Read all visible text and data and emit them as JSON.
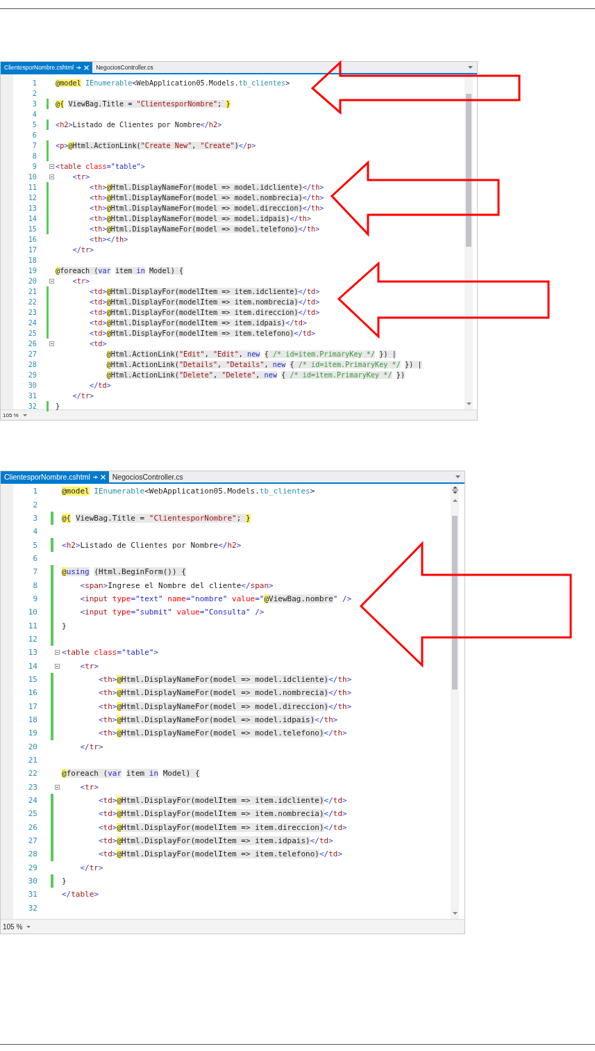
{
  "editors": [
    {
      "tabs": [
        {
          "label": "ClientesporNombre.cshtml",
          "selected": true
        },
        {
          "label": "NegociosController.cs",
          "selected": false
        }
      ],
      "zoom": "105 %",
      "lines": [
        {
          "number": "1",
          "changed": false,
          "fold": false,
          "segments": [
            {
              "text": "@model",
              "kind": "razor"
            },
            {
              "text": " IEnumerable",
              "kind": "type"
            },
            {
              "text": "<WebApplication05.Models.",
              "kind": "plain"
            },
            {
              "text": "tb_clientes",
              "kind": "type"
            },
            {
              "text": ">",
              "kind": "plain"
            }
          ]
        },
        {
          "number": "2",
          "changed": false,
          "fold": false
        },
        {
          "number": "3",
          "changed": true,
          "fold": false,
          "segments": [
            {
              "text": "@{",
              "kind": "razor"
            },
            {
              "text": " ViewBag.Title = ",
              "kind": "cs"
            },
            {
              "text": "\"ClientesporNombre\"",
              "kind": "cs-str"
            },
            {
              "text": "; ",
              "kind": "cs"
            },
            {
              "text": "}",
              "kind": "razor"
            }
          ]
        },
        {
          "number": "4",
          "changed": false,
          "fold": false
        },
        {
          "number": "5",
          "changed": true,
          "fold": false,
          "segments": [
            {
              "text": "<",
              "kind": "punct"
            },
            {
              "text": "h2",
              "kind": "tag"
            },
            {
              "text": ">",
              "kind": "punct"
            },
            {
              "text": "Listado de Clientes por Nombre",
              "kind": "plain"
            },
            {
              "text": "</",
              "kind": "punct"
            },
            {
              "text": "h2",
              "kind": "tag"
            },
            {
              "text": ">",
              "kind": "punct"
            }
          ]
        },
        {
          "number": "6",
          "changed": false,
          "fold": false
        },
        {
          "number": "7",
          "changed": true,
          "fold": false,
          "segments": [
            {
              "text": "<",
              "kind": "punct"
            },
            {
              "text": "p",
              "kind": "tag"
            },
            {
              "text": ">",
              "kind": "punct"
            },
            {
              "text": "@",
              "kind": "razor"
            },
            {
              "text": "Html.ActionLink(",
              "kind": "cs"
            },
            {
              "text": "\"Create New\"",
              "kind": "cs-str"
            },
            {
              "text": ", ",
              "kind": "cs"
            },
            {
              "text": "\"Create\"",
              "kind": "cs-str"
            },
            {
              "text": ")",
              "kind": "cs"
            },
            {
              "text": "</",
              "kind": "punct"
            },
            {
              "text": "p",
              "kind": "tag"
            },
            {
              "text": ">",
              "kind": "punct"
            }
          ]
        },
        {
          "number": "8",
          "changed": true,
          "fold": false
        },
        {
          "number": "9",
          "changed": false,
          "fold": true,
          "segments": [
            {
              "text": "<",
              "kind": "punct"
            },
            {
              "text": "table",
              "kind": "tag"
            },
            {
              "text": " class",
              "kind": "attr"
            },
            {
              "text": "=",
              "kind": "punct"
            },
            {
              "text": "\"table\"",
              "kind": "value"
            },
            {
              "text": ">",
              "kind": "punct"
            }
          ]
        },
        {
          "number": "10",
          "changed": false,
          "fold": true,
          "segments": [
            {
              "text": "    <",
              "kind": "punct"
            },
            {
              "text": "tr",
              "kind": "tag"
            },
            {
              "text": ">",
              "kind": "punct"
            }
          ]
        },
        {
          "number": "11",
          "changed": true,
          "fold": false,
          "segments": [
            {
              "text": "        <",
              "kind": "punct"
            },
            {
              "text": "th",
              "kind": "tag"
            },
            {
              "text": ">",
              "kind": "punct"
            },
            {
              "text": "@",
              "kind": "razor"
            },
            {
              "text": "Html.DisplayNameFor(model => model.idcliente)",
              "kind": "cs"
            },
            {
              "text": "</",
              "kind": "punct"
            },
            {
              "text": "th",
              "kind": "tag"
            },
            {
              "text": ">",
              "kind": "punct"
            }
          ]
        },
        {
          "number": "12",
          "changed": true,
          "fold": false,
          "segments": [
            {
              "text": "        <",
              "kind": "punct"
            },
            {
              "text": "th",
              "kind": "tag"
            },
            {
              "text": ">",
              "kind": "punct"
            },
            {
              "text": "@",
              "kind": "razor"
            },
            {
              "text": "Html.DisplayNameFor(model => model.nombrecia)",
              "kind": "cs"
            },
            {
              "text": "</",
              "kind": "punct"
            },
            {
              "text": "th",
              "kind": "tag"
            },
            {
              "text": ">",
              "kind": "punct"
            }
          ]
        },
        {
          "number": "13",
          "changed": true,
          "fold": false,
          "segments": [
            {
              "text": "        <",
              "kind": "punct"
            },
            {
              "text": "th",
              "kind": "tag"
            },
            {
              "text": ">",
              "kind": "punct"
            },
            {
              "text": "@",
              "kind": "razor"
            },
            {
              "text": "Html.DisplayNameFor(model => model.direccion)",
              "kind": "cs"
            },
            {
              "text": "</",
              "kind": "punct"
            },
            {
              "text": "th",
              "kind": "tag"
            },
            {
              "text": ">",
              "kind": "punct"
            }
          ]
        },
        {
          "number": "14",
          "changed": true,
          "fold": false,
          "segments": [
            {
              "text": "        <",
              "kind": "punct"
            },
            {
              "text": "th",
              "kind": "tag"
            },
            {
              "text": ">",
              "kind": "punct"
            },
            {
              "text": "@",
              "kind": "razor"
            },
            {
              "text": "Html.DisplayNameFor(model => model.idpais)",
              "kind": "cs"
            },
            {
              "text": "</",
              "kind": "punct"
            },
            {
              "text": "th",
              "kind": "tag"
            },
            {
              "text": ">",
              "kind": "punct"
            }
          ]
        },
        {
          "number": "15",
          "changed": true,
          "fold": false,
          "segments": [
            {
              "text": "        <",
              "kind": "punct"
            },
            {
              "text": "th",
              "kind": "tag"
            },
            {
              "text": ">",
              "kind": "punct"
            },
            {
              "text": "@",
              "kind": "razor"
            },
            {
              "text": "Html.DisplayNameFor(model => model.telefono)",
              "kind": "cs"
            },
            {
              "text": "</",
              "kind": "punct"
            },
            {
              "text": "th",
              "kind": "tag"
            },
            {
              "text": ">",
              "kind": "punct"
            }
          ]
        },
        {
          "number": "16",
          "changed": false,
          "fold": false,
          "segments": [
            {
              "text": "        <",
              "kind": "punct"
            },
            {
              "text": "th",
              "kind": "tag"
            },
            {
              "text": "></",
              "kind": "punct"
            },
            {
              "text": "th",
              "kind": "tag"
            },
            {
              "text": ">",
              "kind": "punct"
            }
          ]
        },
        {
          "number": "17",
          "changed": false,
          "fold": false,
          "segments": [
            {
              "text": "    </",
              "kind": "punct"
            },
            {
              "text": "tr",
              "kind": "tag"
            },
            {
              "text": ">",
              "kind": "punct"
            }
          ]
        },
        {
          "number": "18",
          "changed": false,
          "fold": false
        },
        {
          "number": "19",
          "changed": false,
          "fold": false,
          "segments": [
            {
              "text": "@",
              "kind": "razor"
            },
            {
              "text": "foreach (",
              "kind": "cs"
            },
            {
              "text": "var",
              "kind": "cs-kw"
            },
            {
              "text": " item ",
              "kind": "cs"
            },
            {
              "text": "in",
              "kind": "cs-kw"
            },
            {
              "text": " Model) {",
              "kind": "cs"
            }
          ]
        },
        {
          "number": "20",
          "changed": false,
          "fold": true,
          "segments": [
            {
              "text": "    <",
              "kind": "punct"
            },
            {
              "text": "tr",
              "kind": "tag"
            },
            {
              "text": ">",
              "kind": "punct"
            }
          ]
        },
        {
          "number": "21",
          "changed": true,
          "fold": false,
          "segments": [
            {
              "text": "        <",
              "kind": "punct"
            },
            {
              "text": "td",
              "kind": "tag"
            },
            {
              "text": ">",
              "kind": "punct"
            },
            {
              "text": "@",
              "kind": "razor"
            },
            {
              "text": "Html.DisplayFor(modelItem => item.idcliente)",
              "kind": "cs"
            },
            {
              "text": "</",
              "kind": "punct"
            },
            {
              "text": "td",
              "kind": "tag"
            },
            {
              "text": ">",
              "kind": "punct"
            }
          ]
        },
        {
          "number": "22",
          "changed": true,
          "fold": false,
          "segments": [
            {
              "text": "        <",
              "kind": "punct"
            },
            {
              "text": "td",
              "kind": "tag"
            },
            {
              "text": ">",
              "kind": "punct"
            },
            {
              "text": "@",
              "kind": "razor"
            },
            {
              "text": "Html.DisplayFor(modelItem => item.nombrecia)",
              "kind": "cs"
            },
            {
              "text": "</",
              "kind": "punct"
            },
            {
              "text": "td",
              "kind": "tag"
            },
            {
              "text": ">",
              "kind": "punct"
            }
          ]
        },
        {
          "number": "23",
          "changed": true,
          "fold": false,
          "segments": [
            {
              "text": "        <",
              "kind": "punct"
            },
            {
              "text": "td",
              "kind": "tag"
            },
            {
              "text": ">",
              "kind": "punct"
            },
            {
              "text": "@",
              "kind": "razor"
            },
            {
              "text": "Html.DisplayFor(modelItem => item.direccion)",
              "kind": "cs"
            },
            {
              "text": "</",
              "kind": "punct"
            },
            {
              "text": "td",
              "kind": "tag"
            },
            {
              "text": ">",
              "kind": "punct"
            }
          ]
        },
        {
          "number": "24",
          "changed": true,
          "fold": false,
          "segments": [
            {
              "text": "        <",
              "kind": "punct"
            },
            {
              "text": "td",
              "kind": "tag"
            },
            {
              "text": ">",
              "kind": "punct"
            },
            {
              "text": "@",
              "kind": "razor"
            },
            {
              "text": "Html.DisplayFor(modelItem => item.idpais)",
              "kind": "cs"
            },
            {
              "text": "</",
              "kind": "punct"
            },
            {
              "text": "td",
              "kind": "tag"
            },
            {
              "text": ">",
              "kind": "punct"
            }
          ]
        },
        {
          "number": "25",
          "changed": true,
          "fold": false,
          "segments": [
            {
              "text": "        <",
              "kind": "punct"
            },
            {
              "text": "td",
              "kind": "tag"
            },
            {
              "text": ">",
              "kind": "punct"
            },
            {
              "text": "@",
              "kind": "razor"
            },
            {
              "text": "Html.DisplayFor(modelItem => item.telefono)",
              "kind": "cs"
            },
            {
              "text": "</",
              "kind": "punct"
            },
            {
              "text": "td",
              "kind": "tag"
            },
            {
              "text": ">",
              "kind": "punct"
            }
          ]
        },
        {
          "number": "26",
          "changed": false,
          "fold": true,
          "segments": [
            {
              "text": "        <",
              "kind": "punct"
            },
            {
              "text": "td",
              "kind": "tag"
            },
            {
              "text": ">",
              "kind": "punct"
            }
          ]
        },
        {
          "number": "27",
          "changed": false,
          "fold": false,
          "segments": [
            {
              "text": "            @",
              "kind": "razor"
            },
            {
              "text": "Html.ActionLink(",
              "kind": "cs"
            },
            {
              "text": "\"Edit\"",
              "kind": "cs-str"
            },
            {
              "text": ", ",
              "kind": "cs"
            },
            {
              "text": "\"Edit\"",
              "kind": "cs-str"
            },
            {
              "text": ", ",
              "kind": "cs"
            },
            {
              "text": "new",
              "kind": "cs-kw"
            },
            {
              "text": " { ",
              "kind": "cs"
            },
            {
              "text": "/* id=item.PrimaryKey */",
              "kind": "cs-cmt"
            },
            {
              "text": " }) |",
              "kind": "cs"
            }
          ]
        },
        {
          "number": "28",
          "changed": false,
          "fold": false,
          "segments": [
            {
              "text": "            @",
              "kind": "razor"
            },
            {
              "text": "Html.ActionLink(",
              "kind": "cs"
            },
            {
              "text": "\"Details\"",
              "kind": "cs-str"
            },
            {
              "text": ", ",
              "kind": "cs"
            },
            {
              "text": "\"Details\"",
              "kind": "cs-str"
            },
            {
              "text": ", ",
              "kind": "cs"
            },
            {
              "text": "new",
              "kind": "cs-kw"
            },
            {
              "text": " { ",
              "kind": "cs"
            },
            {
              "text": "/* id=item.PrimaryKey */",
              "kind": "cs-cmt"
            },
            {
              "text": " }) |",
              "kind": "cs"
            }
          ]
        },
        {
          "number": "29",
          "changed": false,
          "fold": false,
          "segments": [
            {
              "text": "            @",
              "kind": "razor"
            },
            {
              "text": "Html.ActionLink(",
              "kind": "cs"
            },
            {
              "text": "\"Delete\"",
              "kind": "cs-str"
            },
            {
              "text": ", ",
              "kind": "cs"
            },
            {
              "text": "\"Delete\"",
              "kind": "cs-str"
            },
            {
              "text": ", ",
              "kind": "cs"
            },
            {
              "text": "new",
              "kind": "cs-kw"
            },
            {
              "text": " { ",
              "kind": "cs"
            },
            {
              "text": "/* id=item.PrimaryKey */",
              "kind": "cs-cmt"
            },
            {
              "text": " })",
              "kind": "cs"
            }
          ]
        },
        {
          "number": "30",
          "changed": false,
          "fold": false,
          "segments": [
            {
              "text": "        </",
              "kind": "punct"
            },
            {
              "text": "td",
              "kind": "tag"
            },
            {
              "text": ">",
              "kind": "punct"
            }
          ]
        },
        {
          "number": "31",
          "changed": false,
          "fold": false,
          "segments": [
            {
              "text": "    </",
              "kind": "punct"
            },
            {
              "text": "tr",
              "kind": "tag"
            },
            {
              "text": ">",
              "kind": "punct"
            }
          ]
        },
        {
          "number": "32",
          "changed": true,
          "fold": false,
          "segments": [
            {
              "text": "}",
              "kind": "plain"
            }
          ]
        }
      ]
    },
    {
      "tabs": [
        {
          "label": "ClientesporNombre.cshtml",
          "selected": true
        },
        {
          "label": "NegociosController.cs",
          "selected": false
        }
      ],
      "zoom": "105 %",
      "lines": [
        {
          "number": "1",
          "changed": false,
          "fold": false,
          "segments": [
            {
              "text": "@model",
              "kind": "razor"
            },
            {
              "text": " IEnumerable",
              "kind": "type"
            },
            {
              "text": "<WebApplication05.Models.",
              "kind": "plain"
            },
            {
              "text": "tb_clientes",
              "kind": "type"
            },
            {
              "text": ">",
              "kind": "plain"
            }
          ]
        },
        {
          "number": "2",
          "changed": false,
          "fold": false
        },
        {
          "number": "3",
          "changed": true,
          "fold": false,
          "segments": [
            {
              "text": "@{",
              "kind": "razor"
            },
            {
              "text": " ViewBag.Title = ",
              "kind": "cs"
            },
            {
              "text": "\"ClientesporNombre\"",
              "kind": "cs-str"
            },
            {
              "text": "; ",
              "kind": "cs"
            },
            {
              "text": "}",
              "kind": "razor"
            }
          ]
        },
        {
          "number": "4",
          "changed": false,
          "fold": false
        },
        {
          "number": "5",
          "changed": true,
          "fold": false,
          "segments": [
            {
              "text": "<",
              "kind": "punct"
            },
            {
              "text": "h2",
              "kind": "tag"
            },
            {
              "text": ">",
              "kind": "punct"
            },
            {
              "text": "Listado de Clientes por Nombre",
              "kind": "plain"
            },
            {
              "text": "</",
              "kind": "punct"
            },
            {
              "text": "h2",
              "kind": "tag"
            },
            {
              "text": ">",
              "kind": "punct"
            }
          ]
        },
        {
          "number": "6",
          "changed": false,
          "fold": false
        },
        {
          "number": "7",
          "changed": true,
          "fold": false,
          "segments": [
            {
              "text": "@",
              "kind": "razor"
            },
            {
              "text": "using",
              "kind": "cs-kw"
            },
            {
              "text": " (Html.BeginForm()) {",
              "kind": "cs"
            }
          ]
        },
        {
          "number": "8",
          "changed": true,
          "fold": false,
          "segments": [
            {
              "text": "    <",
              "kind": "punct"
            },
            {
              "text": "span",
              "kind": "tag"
            },
            {
              "text": ">",
              "kind": "punct"
            },
            {
              "text": "Ingrese el Nombre del cliente",
              "kind": "plain"
            },
            {
              "text": "</",
              "kind": "punct"
            },
            {
              "text": "span",
              "kind": "tag"
            },
            {
              "text": ">",
              "kind": "punct"
            }
          ]
        },
        {
          "number": "9",
          "changed": true,
          "fold": false,
          "segments": [
            {
              "text": "    <",
              "kind": "punct"
            },
            {
              "text": "input",
              "kind": "tag"
            },
            {
              "text": " type",
              "kind": "attr"
            },
            {
              "text": "=",
              "kind": "punct"
            },
            {
              "text": "\"text\"",
              "kind": "value"
            },
            {
              "text": " name",
              "kind": "attr"
            },
            {
              "text": "=",
              "kind": "punct"
            },
            {
              "text": "\"nombre\"",
              "kind": "value"
            },
            {
              "text": " value",
              "kind": "attr"
            },
            {
              "text": "=",
              "kind": "punct"
            },
            {
              "text": "\"",
              "kind": "value"
            },
            {
              "text": "@",
              "kind": "razor"
            },
            {
              "text": "ViewBag.nombre",
              "kind": "cs"
            },
            {
              "text": "\"",
              "kind": "value"
            },
            {
              "text": " />",
              "kind": "punct"
            }
          ]
        },
        {
          "number": "10",
          "changed": true,
          "fold": false,
          "segments": [
            {
              "text": "    <",
              "kind": "punct"
            },
            {
              "text": "input",
              "kind": "tag"
            },
            {
              "text": " type",
              "kind": "attr"
            },
            {
              "text": "=",
              "kind": "punct"
            },
            {
              "text": "\"submit\"",
              "kind": "value"
            },
            {
              "text": " value",
              "kind": "attr"
            },
            {
              "text": "=",
              "kind": "punct"
            },
            {
              "text": "\"Consulta\"",
              "kind": "value"
            },
            {
              "text": " />",
              "kind": "punct"
            }
          ]
        },
        {
          "number": "11",
          "changed": true,
          "fold": false,
          "segments": [
            {
              "text": "}",
              "kind": "plain"
            }
          ]
        },
        {
          "number": "12",
          "changed": true,
          "fold": false
        },
        {
          "number": "13",
          "changed": false,
          "fold": true,
          "segments": [
            {
              "text": "<",
              "kind": "punct"
            },
            {
              "text": "table",
              "kind": "tag"
            },
            {
              "text": " class",
              "kind": "attr"
            },
            {
              "text": "=",
              "kind": "punct"
            },
            {
              "text": "\"table\"",
              "kind": "value"
            },
            {
              "text": ">",
              "kind": "punct"
            }
          ]
        },
        {
          "number": "14",
          "changed": false,
          "fold": true,
          "segments": [
            {
              "text": "    <",
              "kind": "punct"
            },
            {
              "text": "tr",
              "kind": "tag"
            },
            {
              "text": ">",
              "kind": "punct"
            }
          ]
        },
        {
          "number": "15",
          "changed": true,
          "fold": false,
          "segments": [
            {
              "text": "        <",
              "kind": "punct"
            },
            {
              "text": "th",
              "kind": "tag"
            },
            {
              "text": ">",
              "kind": "punct"
            },
            {
              "text": "@",
              "kind": "razor"
            },
            {
              "text": "Html.DisplayNameFor(model => model.idcliente)",
              "kind": "cs"
            },
            {
              "text": "</",
              "kind": "punct"
            },
            {
              "text": "th",
              "kind": "tag"
            },
            {
              "text": ">",
              "kind": "punct"
            }
          ]
        },
        {
          "number": "16",
          "changed": true,
          "fold": false,
          "segments": [
            {
              "text": "        <",
              "kind": "punct"
            },
            {
              "text": "th",
              "kind": "tag"
            },
            {
              "text": ">",
              "kind": "punct"
            },
            {
              "text": "@",
              "kind": "razor"
            },
            {
              "text": "Html.DisplayNameFor(model => model.nombrecia)",
              "kind": "cs"
            },
            {
              "text": "</",
              "kind": "punct"
            },
            {
              "text": "th",
              "kind": "tag"
            },
            {
              "text": ">",
              "kind": "punct"
            }
          ]
        },
        {
          "number": "17",
          "changed": true,
          "fold": false,
          "segments": [
            {
              "text": "        <",
              "kind": "punct"
            },
            {
              "text": "th",
              "kind": "tag"
            },
            {
              "text": ">",
              "kind": "punct"
            },
            {
              "text": "@",
              "kind": "razor"
            },
            {
              "text": "Html.DisplayNameFor(model => model.direccion)",
              "kind": "cs"
            },
            {
              "text": "</",
              "kind": "punct"
            },
            {
              "text": "th",
              "kind": "tag"
            },
            {
              "text": ">",
              "kind": "punct"
            }
          ]
        },
        {
          "number": "18",
          "changed": true,
          "fold": false,
          "segments": [
            {
              "text": "        <",
              "kind": "punct"
            },
            {
              "text": "th",
              "kind": "tag"
            },
            {
              "text": ">",
              "kind": "punct"
            },
            {
              "text": "@",
              "kind": "razor"
            },
            {
              "text": "Html.DisplayNameFor(model => model.idpais)",
              "kind": "cs"
            },
            {
              "text": "</",
              "kind": "punct"
            },
            {
              "text": "th",
              "kind": "tag"
            },
            {
              "text": ">",
              "kind": "punct"
            }
          ]
        },
        {
          "number": "19",
          "changed": true,
          "fold": false,
          "segments": [
            {
              "text": "        <",
              "kind": "punct"
            },
            {
              "text": "th",
              "kind": "tag"
            },
            {
              "text": ">",
              "kind": "punct"
            },
            {
              "text": "@",
              "kind": "razor"
            },
            {
              "text": "Html.DisplayNameFor(model => model.telefono)",
              "kind": "cs"
            },
            {
              "text": "</",
              "kind": "punct"
            },
            {
              "text": "th",
              "kind": "tag"
            },
            {
              "text": ">",
              "kind": "punct"
            }
          ]
        },
        {
          "number": "20",
          "changed": false,
          "fold": false,
          "segments": [
            {
              "text": "    </",
              "kind": "punct"
            },
            {
              "text": "tr",
              "kind": "tag"
            },
            {
              "text": ">",
              "kind": "punct"
            }
          ]
        },
        {
          "number": "21",
          "changed": false,
          "fold": false
        },
        {
          "number": "22",
          "changed": false,
          "fold": false,
          "segments": [
            {
              "text": "@",
              "kind": "razor"
            },
            {
              "text": "foreach (",
              "kind": "cs"
            },
            {
              "text": "var",
              "kind": "cs-kw"
            },
            {
              "text": " item ",
              "kind": "cs"
            },
            {
              "text": "in",
              "kind": "cs-kw"
            },
            {
              "text": " Model) {",
              "kind": "cs"
            }
          ]
        },
        {
          "number": "23",
          "changed": false,
          "fold": true,
          "segments": [
            {
              "text": "    <",
              "kind": "punct"
            },
            {
              "text": "tr",
              "kind": "tag"
            },
            {
              "text": ">",
              "kind": "punct"
            }
          ]
        },
        {
          "number": "24",
          "changed": true,
          "fold": false,
          "segments": [
            {
              "text": "        <",
              "kind": "punct"
            },
            {
              "text": "td",
              "kind": "tag"
            },
            {
              "text": ">",
              "kind": "punct"
            },
            {
              "text": "@",
              "kind": "razor"
            },
            {
              "text": "Html.DisplayFor(modelItem => item.idcliente)",
              "kind": "cs"
            },
            {
              "text": "</",
              "kind": "punct"
            },
            {
              "text": "td",
              "kind": "tag"
            },
            {
              "text": ">",
              "kind": "punct"
            }
          ]
        },
        {
          "number": "25",
          "changed": true,
          "fold": false,
          "segments": [
            {
              "text": "        <",
              "kind": "punct"
            },
            {
              "text": "td",
              "kind": "tag"
            },
            {
              "text": ">",
              "kind": "punct"
            },
            {
              "text": "@",
              "kind": "razor"
            },
            {
              "text": "Html.DisplayFor(modelItem => item.nombrecia)",
              "kind": "cs"
            },
            {
              "text": "</",
              "kind": "punct"
            },
            {
              "text": "td",
              "kind": "tag"
            },
            {
              "text": ">",
              "kind": "punct"
            }
          ]
        },
        {
          "number": "26",
          "changed": true,
          "fold": false,
          "segments": [
            {
              "text": "        <",
              "kind": "punct"
            },
            {
              "text": "td",
              "kind": "tag"
            },
            {
              "text": ">",
              "kind": "punct"
            },
            {
              "text": "@",
              "kind": "razor"
            },
            {
              "text": "Html.DisplayFor(modelItem => item.direccion)",
              "kind": "cs"
            },
            {
              "text": "</",
              "kind": "punct"
            },
            {
              "text": "td",
              "kind": "tag"
            },
            {
              "text": ">",
              "kind": "punct"
            }
          ]
        },
        {
          "number": "27",
          "changed": true,
          "fold": false,
          "segments": [
            {
              "text": "        <",
              "kind": "punct"
            },
            {
              "text": "td",
              "kind": "tag"
            },
            {
              "text": ">",
              "kind": "punct"
            },
            {
              "text": "@",
              "kind": "razor"
            },
            {
              "text": "Html.DisplayFor(modelItem => item.idpais)",
              "kind": "cs"
            },
            {
              "text": "</",
              "kind": "punct"
            },
            {
              "text": "td",
              "kind": "tag"
            },
            {
              "text": ">",
              "kind": "punct"
            }
          ]
        },
        {
          "number": "28",
          "changed": true,
          "fold": false,
          "segments": [
            {
              "text": "        <",
              "kind": "punct"
            },
            {
              "text": "td",
              "kind": "tag"
            },
            {
              "text": ">",
              "kind": "punct"
            },
            {
              "text": "@",
              "kind": "razor"
            },
            {
              "text": "Html.DisplayFor(modelItem => item.telefono)",
              "kind": "cs"
            },
            {
              "text": "</",
              "kind": "punct"
            },
            {
              "text": "td",
              "kind": "tag"
            },
            {
              "text": ">",
              "kind": "punct"
            }
          ]
        },
        {
          "number": "29",
          "changed": false,
          "fold": false,
          "segments": [
            {
              "text": "    </",
              "kind": "punct"
            },
            {
              "text": "tr",
              "kind": "tag"
            },
            {
              "text": ">",
              "kind": "punct"
            }
          ]
        },
        {
          "number": "30",
          "changed": true,
          "fold": false,
          "segments": [
            {
              "text": "}",
              "kind": "plain"
            }
          ]
        },
        {
          "number": "31",
          "changed": false,
          "fold": false,
          "segments": [
            {
              "text": "</",
              "kind": "punct"
            },
            {
              "text": "table",
              "kind": "tag"
            },
            {
              "text": ">",
              "kind": "punct"
            }
          ]
        },
        {
          "number": "32",
          "changed": false,
          "fold": false
        }
      ]
    }
  ]
}
